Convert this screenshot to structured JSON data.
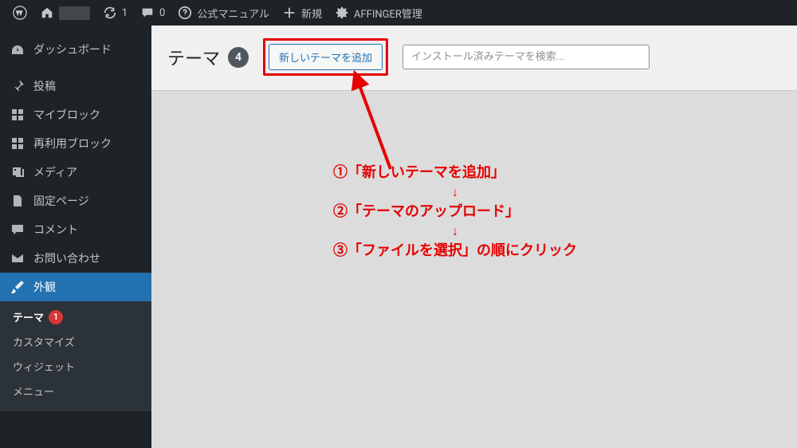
{
  "adminbar": {
    "updates_count": "1",
    "comments_count": "0",
    "manual_label": "公式マニュアル",
    "new_label": "新規",
    "affinger_label": "AFFINGER管理"
  },
  "sidebar": {
    "dashboard": "ダッシュボード",
    "items": [
      {
        "label": "投稿",
        "icon": "pin"
      },
      {
        "label": "マイブロック",
        "icon": "grid"
      },
      {
        "label": "再利用ブロック",
        "icon": "grid"
      },
      {
        "label": "メディア",
        "icon": "media"
      },
      {
        "label": "固定ページ",
        "icon": "pages"
      },
      {
        "label": "コメント",
        "icon": "comment"
      },
      {
        "label": "お問い合わせ",
        "icon": "envelope"
      }
    ],
    "appearance": {
      "label": "外観"
    },
    "submenu": {
      "theme": {
        "label": "テーマ",
        "count": "1"
      },
      "customize": "カスタマイズ",
      "widgets": "ウィジェット",
      "menus": "メニュー"
    }
  },
  "header": {
    "title": "テーマ",
    "count": "4",
    "add_new": "新しいテーマを追加",
    "search_placeholder": "インストール済みテーマを検索..."
  },
  "annotation": {
    "line1": "①「新しいテーマを追加」",
    "line2": "②「テーマのアップロード」",
    "line3": "③「ファイルを選択」の順にクリック",
    "down_arrow": "↓"
  }
}
